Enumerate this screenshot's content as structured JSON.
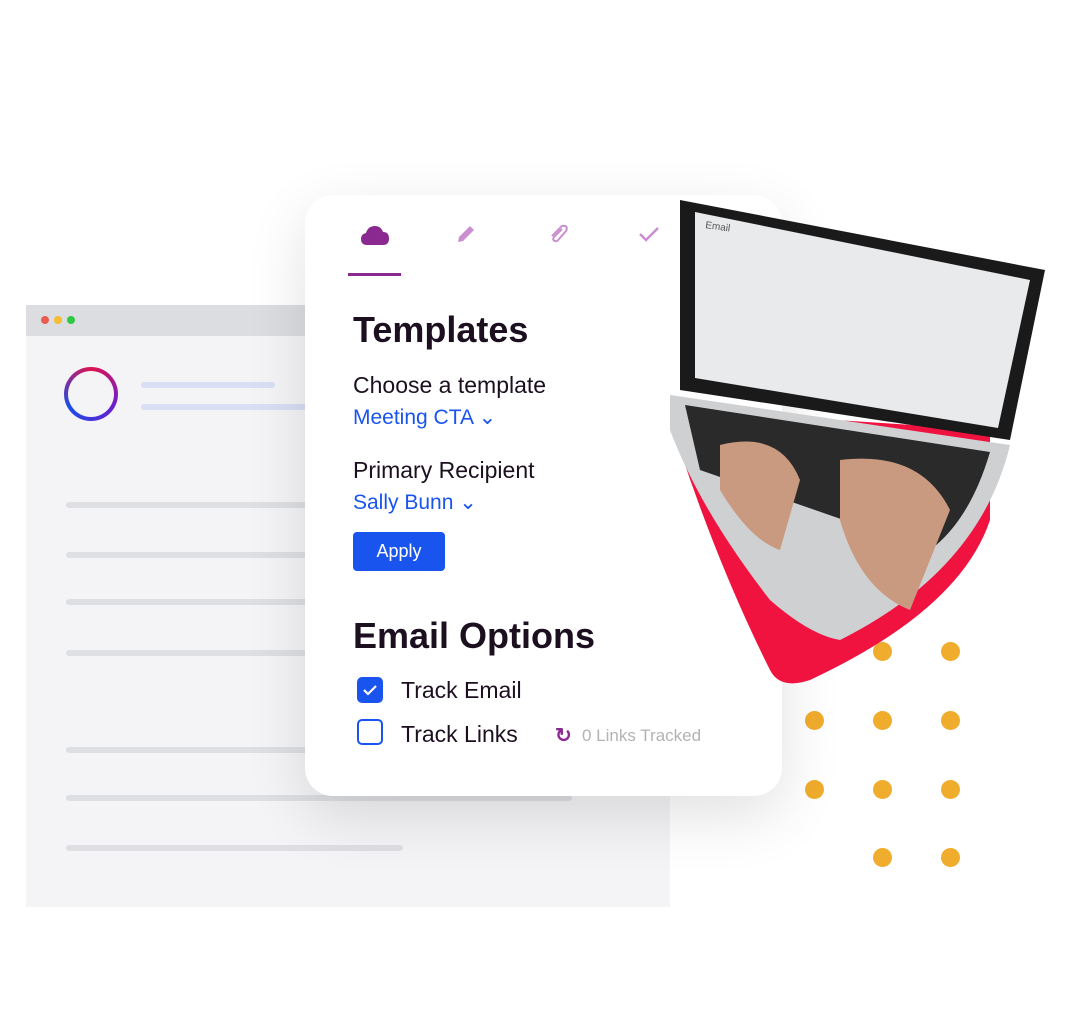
{
  "colors": {
    "accent": "#1a54ef",
    "tab_active": "#8a2a90",
    "tab_inactive": "#c98fd0",
    "brand_red": "#f0123f",
    "dots": "#f0ac2c"
  },
  "tabs": [
    {
      "icon": "cloud-icon",
      "active": true
    },
    {
      "icon": "pencil-icon",
      "active": false
    },
    {
      "icon": "paperclip-icon",
      "active": false
    },
    {
      "icon": "check-icon",
      "active": false
    }
  ],
  "templates": {
    "title": "Templates",
    "choose_label": "Choose a template",
    "template_value": "Meeting CTA",
    "recipient_label": "Primary Recipient",
    "recipient_value": "Sally Bunn",
    "apply_label": "Apply"
  },
  "email_options": {
    "title": "Email Options",
    "track_email": {
      "label": "Track Email",
      "checked": true
    },
    "track_links": {
      "label": "Track Links",
      "checked": false
    },
    "links_tracked": "0 Links Tracked"
  },
  "laptop_screen": {
    "title": "Email"
  }
}
